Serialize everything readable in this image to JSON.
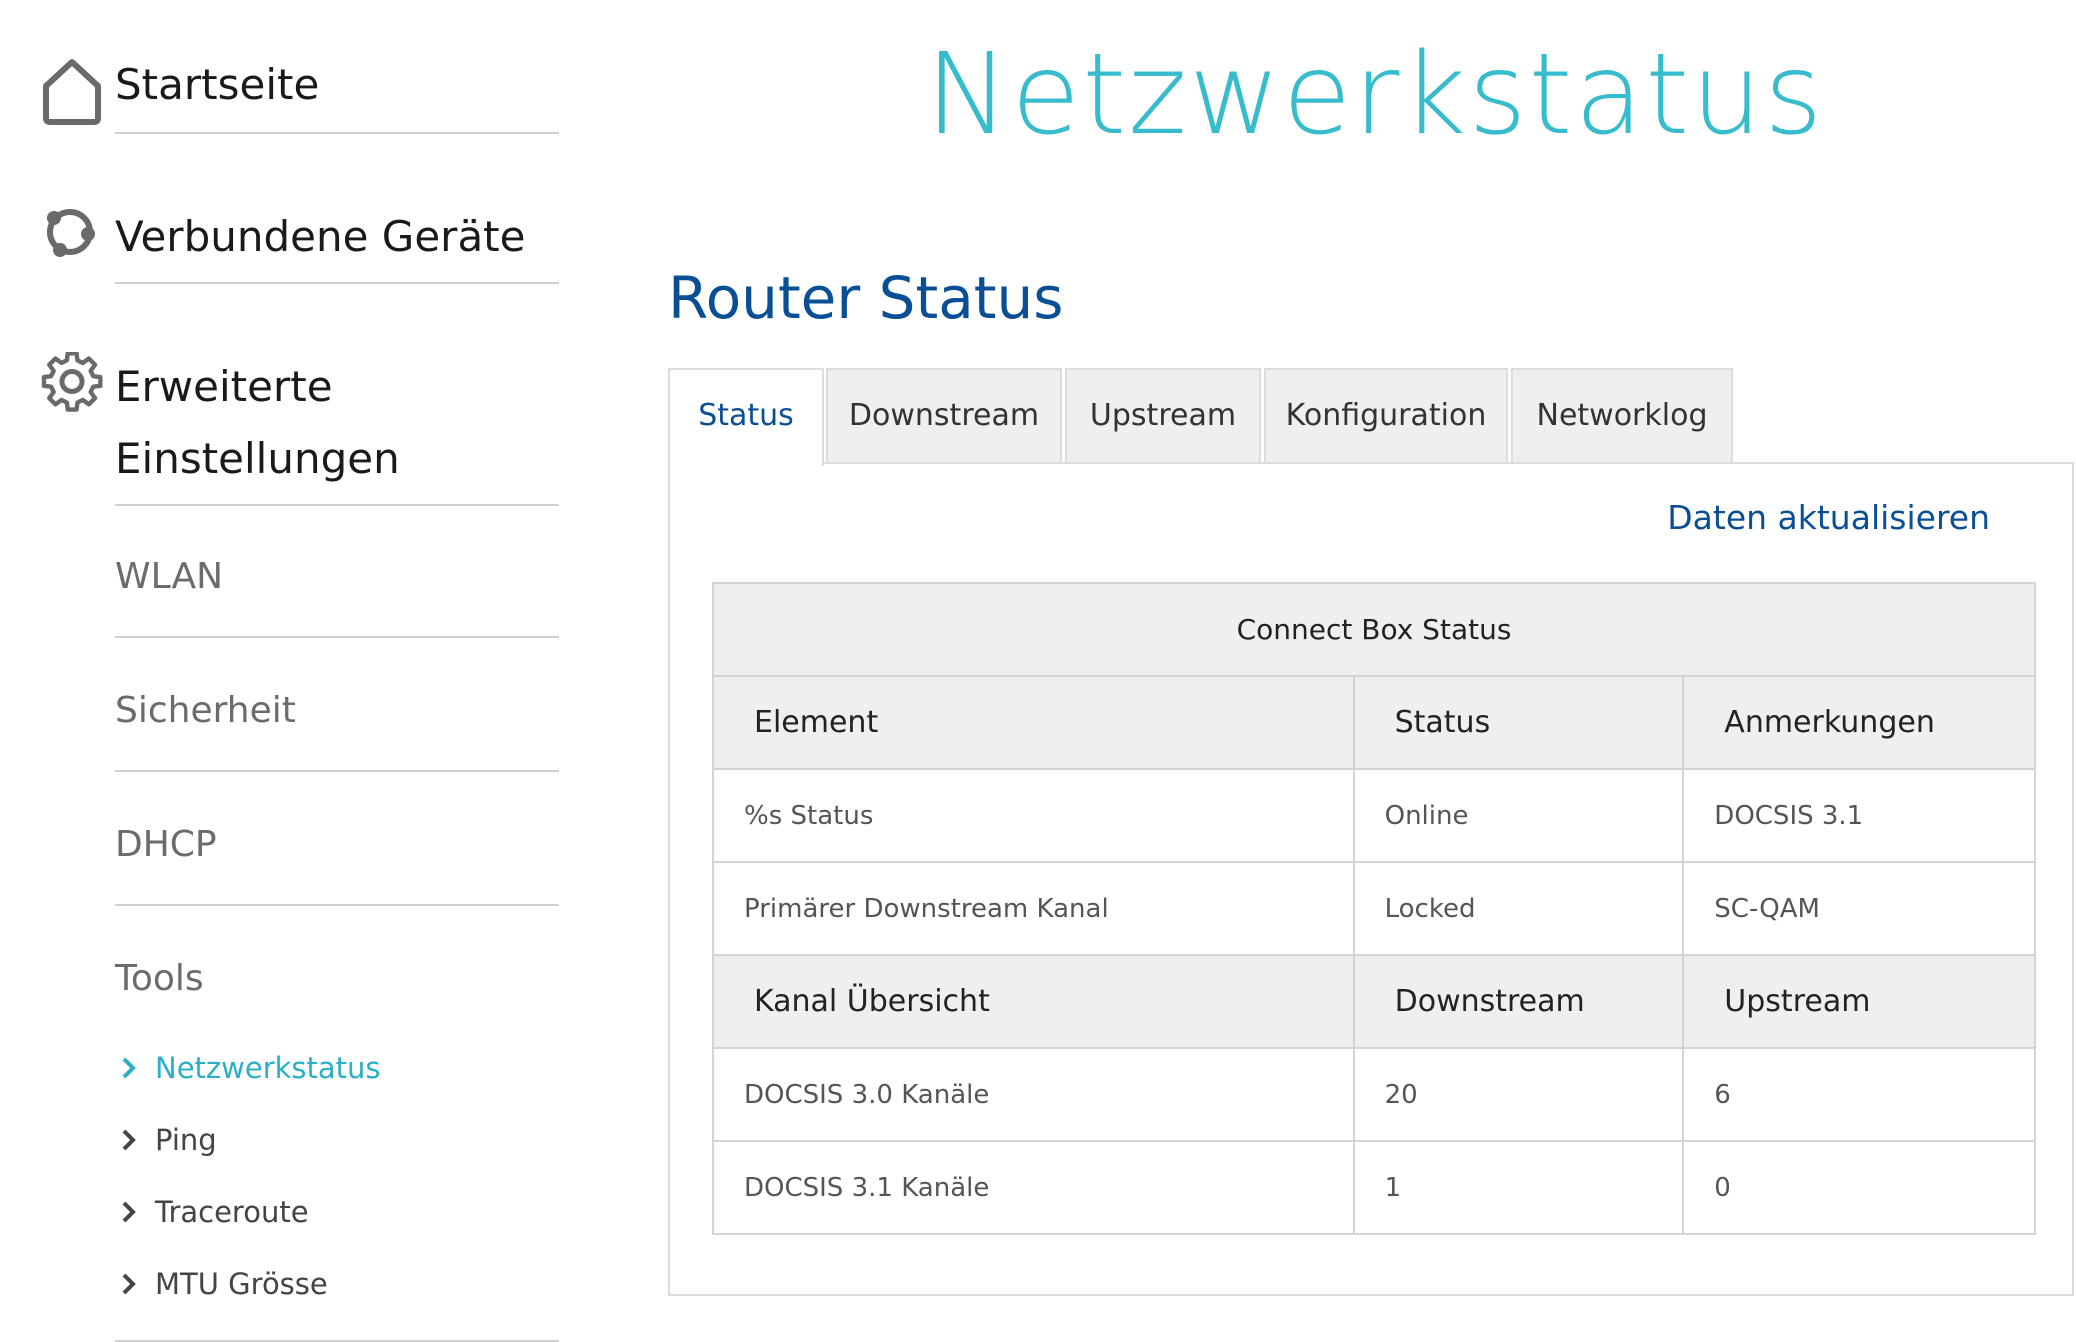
{
  "sidebar": {
    "main_items": [
      {
        "label": "Startseite",
        "icon": "home-icon"
      },
      {
        "label": "Verbundene Geräte",
        "icon": "connected-devices-icon"
      },
      {
        "label_line1": "Erweiterte",
        "label_line2": "Einstellungen",
        "icon": "gear-icon"
      }
    ],
    "sub_items": [
      "WLAN",
      "Sicherheit",
      "DHCP",
      "Tools"
    ],
    "tools": [
      {
        "label": "Netzwerkstatus",
        "active": true
      },
      {
        "label": "Ping",
        "active": false
      },
      {
        "label": "Traceroute",
        "active": false
      },
      {
        "label": "MTU Grösse",
        "active": false
      }
    ]
  },
  "page_title": "Netzwerkstatus",
  "section_title": "Router Status",
  "tabs": [
    "Status",
    "Downstream",
    "Upstream",
    "Konfiguration",
    "Networklog"
  ],
  "active_tab": "Status",
  "refresh_label": "Daten aktualisieren",
  "table": {
    "caption": "Connect Box Status",
    "header1": [
      "Element",
      "Status",
      "Anmerkungen"
    ],
    "rows1": [
      [
        "%s Status",
        "Online",
        "DOCSIS 3.1"
      ],
      [
        "Primärer Downstream Kanal",
        "Locked",
        "SC-QAM"
      ]
    ],
    "header2": [
      "Kanal Übersicht",
      "Downstream",
      "Upstream"
    ],
    "rows2": [
      [
        "DOCSIS 3.0 Kanäle",
        "20",
        "6"
      ],
      [
        "DOCSIS 3.1 Kanäle",
        "1",
        "0"
      ]
    ]
  },
  "colors": {
    "title_teal": "#37bccd",
    "accent_blue": "#0a4f96",
    "active_tool": "#2ab0c4",
    "header_bg": "#efefef"
  }
}
